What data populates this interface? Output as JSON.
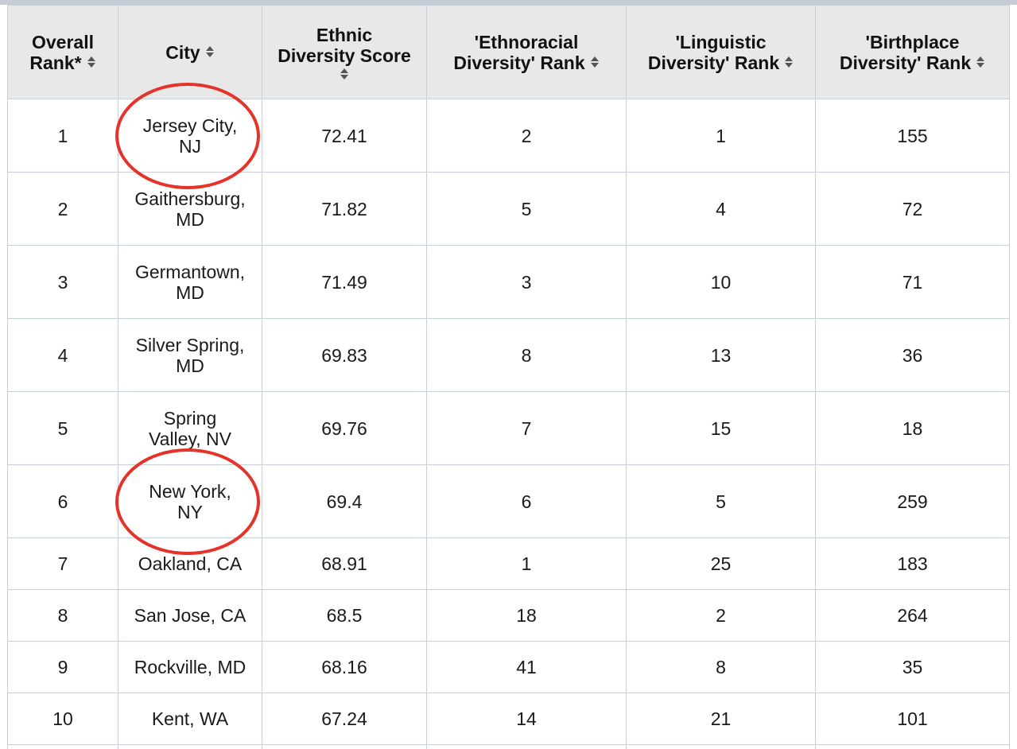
{
  "table": {
    "headers": [
      {
        "line1": "Overall",
        "line2": "Rank*",
        "sort_icon": "sort-both-icon"
      },
      {
        "line1": "City",
        "line2": "",
        "sort_icon": "sort-both-icon"
      },
      {
        "line1": "Ethnic",
        "line2": "Diversity Score",
        "sort_icon": "sort-both-icon"
      },
      {
        "line1": "'Ethnoracial",
        "line2": "Diversity' Rank",
        "sort_icon": "sort-both-icon"
      },
      {
        "line1": "'Linguistic",
        "line2": "Diversity' Rank",
        "sort_icon": "sort-both-icon"
      },
      {
        "line1": "'Birthplace",
        "line2": "Diversity' Rank",
        "sort_icon": "sort-both-icon"
      }
    ],
    "rows": [
      {
        "rank": "1",
        "city_line1": "Jersey City,",
        "city_line2": "NJ",
        "score": "72.41",
        "ethnoracial": "2",
        "linguistic": "1",
        "birthplace": "155",
        "highlighted": true
      },
      {
        "rank": "2",
        "city_line1": "Gaithersburg,",
        "city_line2": "MD",
        "score": "71.82",
        "ethnoracial": "5",
        "linguistic": "4",
        "birthplace": "72",
        "highlighted": false
      },
      {
        "rank": "3",
        "city_line1": "Germantown,",
        "city_line2": "MD",
        "score": "71.49",
        "ethnoracial": "3",
        "linguistic": "10",
        "birthplace": "71",
        "highlighted": false
      },
      {
        "rank": "4",
        "city_line1": "Silver Spring,",
        "city_line2": "MD",
        "score": "69.83",
        "ethnoracial": "8",
        "linguistic": "13",
        "birthplace": "36",
        "highlighted": false
      },
      {
        "rank": "5",
        "city_line1": "Spring",
        "city_line2": "Valley, NV",
        "score": "69.76",
        "ethnoracial": "7",
        "linguistic": "15",
        "birthplace": "18",
        "highlighted": false
      },
      {
        "rank": "6",
        "city_line1": "New York,",
        "city_line2": "NY",
        "score": "69.4",
        "ethnoracial": "6",
        "linguistic": "5",
        "birthplace": "259",
        "highlighted": true
      },
      {
        "rank": "7",
        "city_line1": "Oakland, CA",
        "city_line2": "",
        "score": "68.91",
        "ethnoracial": "1",
        "linguistic": "25",
        "birthplace": "183",
        "highlighted": false
      },
      {
        "rank": "8",
        "city_line1": "San Jose, CA",
        "city_line2": "",
        "score": "68.5",
        "ethnoracial": "18",
        "linguistic": "2",
        "birthplace": "264",
        "highlighted": false
      },
      {
        "rank": "9",
        "city_line1": "Rockville, MD",
        "city_line2": "",
        "score": "68.16",
        "ethnoracial": "41",
        "linguistic": "8",
        "birthplace": "35",
        "highlighted": false
      },
      {
        "rank": "10",
        "city_line1": "Kent, WA",
        "city_line2": "",
        "score": "67.24",
        "ethnoracial": "14",
        "linguistic": "21",
        "birthplace": "101",
        "highlighted": false
      }
    ]
  },
  "colors": {
    "header_bg": "#e8e8e8",
    "grid": "#c7d0d8",
    "highlight": "#e6332a"
  }
}
